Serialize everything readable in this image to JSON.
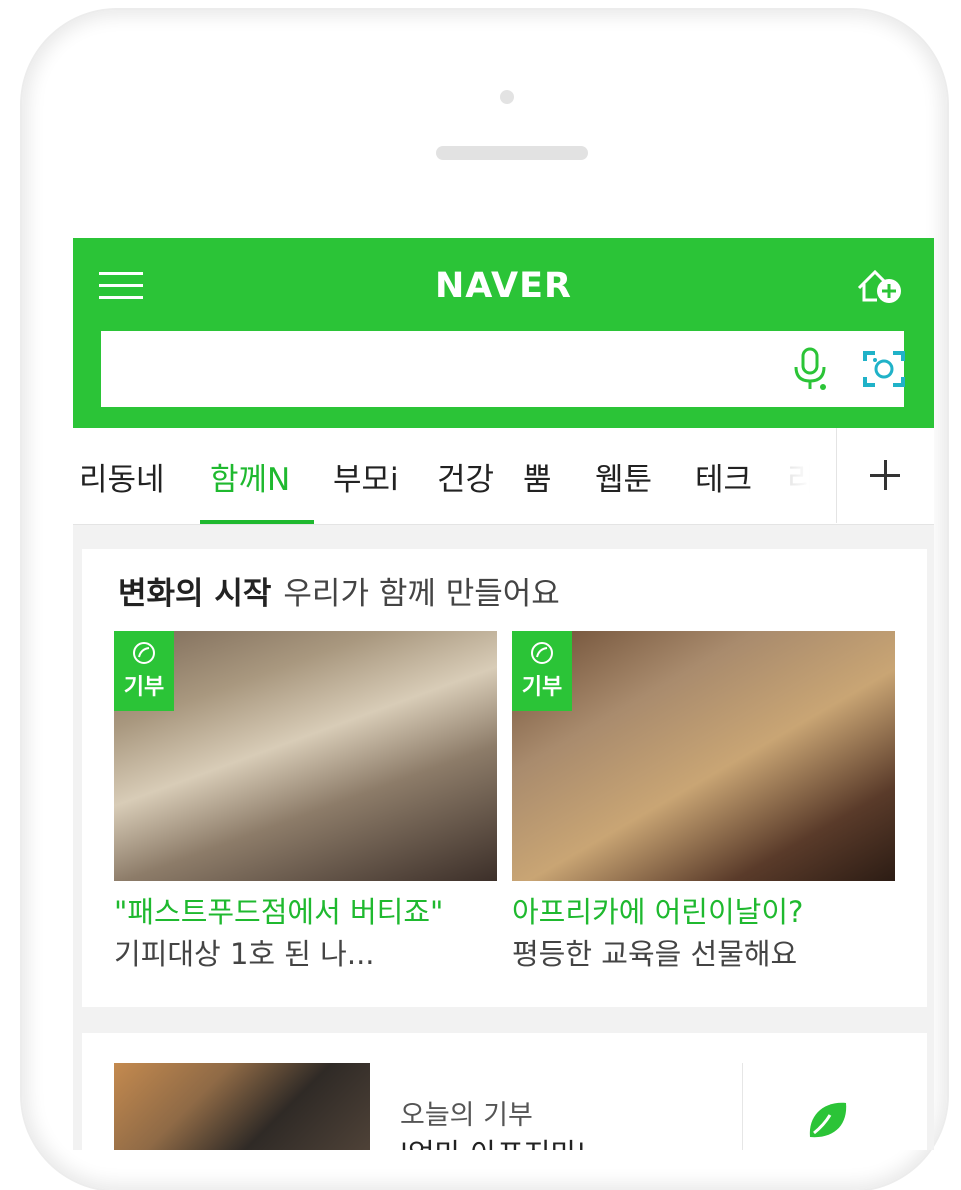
{
  "header": {
    "logo": "NAVER"
  },
  "search": {
    "value": "",
    "placeholder": ""
  },
  "tabs": [
    {
      "label": "리동네"
    },
    {
      "label": "함께N",
      "active": true
    },
    {
      "label": "부모i"
    },
    {
      "label": "건강"
    },
    {
      "label": "뿜"
    },
    {
      "label": "웹툰"
    },
    {
      "label": "테크"
    },
    {
      "label": "리"
    }
  ],
  "section": {
    "title_strong": "변화의 시작",
    "title_light": "우리가 함께 만들어요",
    "items": [
      {
        "badge": "기부",
        "caption_highlight": "\"패스트푸드점에서 버티죠\"",
        "caption_rest": " 기피대상 1호 된 나..."
      },
      {
        "badge": "기부",
        "caption_highlight": "아프리카에 어린이날이?",
        "caption_rest": "평등한 교육을 선물해요"
      }
    ]
  },
  "today": {
    "label": "오늘의 기부",
    "title": "'엄마 아프지마'"
  },
  "colors": {
    "brand_green": "#2bc437",
    "accent_green": "#1fb92f"
  }
}
